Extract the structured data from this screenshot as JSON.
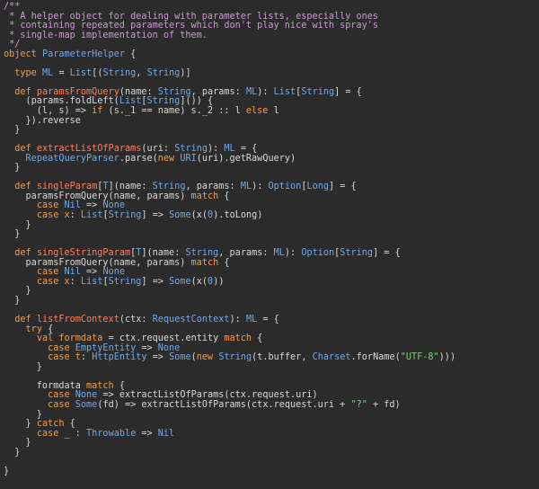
{
  "editor": {
    "language": "scala",
    "theme": {
      "background": "#2b2b2b",
      "text": "#d8d8d8",
      "comment": "#c89bd0",
      "keyword": "#f29d45",
      "type": "#6fa9e8",
      "definition": "#ff7f5a",
      "string": "#7bd17b"
    },
    "lines": [
      [
        [
          "c",
          "/**"
        ]
      ],
      [
        [
          "c",
          " * A helper object for dealing with parameter lists, especially ones"
        ]
      ],
      [
        [
          "c",
          " * containing repeated parameters which don't play nice with spray's"
        ]
      ],
      [
        [
          "c",
          " * single-map implementation of them."
        ]
      ],
      [
        [
          "c",
          " */"
        ]
      ],
      [
        [
          "k",
          "object"
        ],
        [
          "t",
          " "
        ],
        [
          "y",
          "ParameterHelper"
        ],
        [
          "t",
          " {"
        ]
      ],
      [
        [
          "t",
          ""
        ]
      ],
      [
        [
          "t",
          "  "
        ],
        [
          "k",
          "type"
        ],
        [
          "t",
          " "
        ],
        [
          "y",
          "ML"
        ],
        [
          "t",
          " = "
        ],
        [
          "y",
          "List"
        ],
        [
          "t",
          "[("
        ],
        [
          "y",
          "String"
        ],
        [
          "t",
          ", "
        ],
        [
          "y",
          "String"
        ],
        [
          "t",
          ")]"
        ]
      ],
      [
        [
          "t",
          ""
        ]
      ],
      [
        [
          "t",
          "  "
        ],
        [
          "k",
          "def"
        ],
        [
          "t",
          " "
        ],
        [
          "d",
          "paramsFromQuery"
        ],
        [
          "t",
          "(name: "
        ],
        [
          "y",
          "String"
        ],
        [
          "t",
          ", params: "
        ],
        [
          "y",
          "ML"
        ],
        [
          "t",
          "): "
        ],
        [
          "y",
          "List"
        ],
        [
          "t",
          "["
        ],
        [
          "y",
          "String"
        ],
        [
          "t",
          "] = {"
        ]
      ],
      [
        [
          "t",
          "    (params.foldLeft("
        ],
        [
          "y",
          "List"
        ],
        [
          "t",
          "["
        ],
        [
          "y",
          "String"
        ],
        [
          "t",
          "]()) {"
        ]
      ],
      [
        [
          "t",
          "      (l, s) => "
        ],
        [
          "k",
          "if"
        ],
        [
          "t",
          " (s._1 == name) s._2 :: l "
        ],
        [
          "k",
          "else"
        ],
        [
          "t",
          " l"
        ]
      ],
      [
        [
          "t",
          "    }).reverse"
        ]
      ],
      [
        [
          "t",
          "  }"
        ]
      ],
      [
        [
          "t",
          ""
        ]
      ],
      [
        [
          "t",
          "  "
        ],
        [
          "k",
          "def"
        ],
        [
          "t",
          " "
        ],
        [
          "d",
          "extractListOfParams"
        ],
        [
          "t",
          "(uri: "
        ],
        [
          "y",
          "String"
        ],
        [
          "t",
          "): "
        ],
        [
          "y",
          "ML"
        ],
        [
          "t",
          " = {"
        ]
      ],
      [
        [
          "t",
          "    "
        ],
        [
          "y",
          "RepeatQueryParser"
        ],
        [
          "t",
          ".parse("
        ],
        [
          "k",
          "new"
        ],
        [
          "t",
          " "
        ],
        [
          "y",
          "URI"
        ],
        [
          "t",
          "(uri).getRawQuery)"
        ]
      ],
      [
        [
          "t",
          "  }"
        ]
      ],
      [
        [
          "t",
          ""
        ]
      ],
      [
        [
          "t",
          "  "
        ],
        [
          "k",
          "def"
        ],
        [
          "t",
          " "
        ],
        [
          "d",
          "singleParam"
        ],
        [
          "t",
          "["
        ],
        [
          "y",
          "T"
        ],
        [
          "t",
          "](name: "
        ],
        [
          "y",
          "String"
        ],
        [
          "t",
          ", params: "
        ],
        [
          "y",
          "ML"
        ],
        [
          "t",
          "): "
        ],
        [
          "y",
          "Option"
        ],
        [
          "t",
          "["
        ],
        [
          "y",
          "Long"
        ],
        [
          "t",
          "] = {"
        ]
      ],
      [
        [
          "t",
          "    paramsFromQuery(name, params) "
        ],
        [
          "k",
          "match"
        ],
        [
          "t",
          " {"
        ]
      ],
      [
        [
          "t",
          "      "
        ],
        [
          "k",
          "case"
        ],
        [
          "t",
          " "
        ],
        [
          "y",
          "Nil"
        ],
        [
          "t",
          " => "
        ],
        [
          "y",
          "None"
        ]
      ],
      [
        [
          "t",
          "      "
        ],
        [
          "k",
          "case"
        ],
        [
          "t",
          " "
        ],
        [
          "k",
          "x"
        ],
        [
          "t",
          ": "
        ],
        [
          "y",
          "List"
        ],
        [
          "t",
          "["
        ],
        [
          "y",
          "String"
        ],
        [
          "t",
          "] => "
        ],
        [
          "y",
          "Some"
        ],
        [
          "t",
          "(x("
        ],
        [
          "y",
          "0"
        ],
        [
          "t",
          ").toLong)"
        ]
      ],
      [
        [
          "t",
          "    }"
        ]
      ],
      [
        [
          "t",
          "  }"
        ]
      ],
      [
        [
          "t",
          ""
        ]
      ],
      [
        [
          "t",
          "  "
        ],
        [
          "k",
          "def"
        ],
        [
          "t",
          " "
        ],
        [
          "d",
          "singleStringParam"
        ],
        [
          "t",
          "["
        ],
        [
          "y",
          "T"
        ],
        [
          "t",
          "](name: "
        ],
        [
          "y",
          "String"
        ],
        [
          "t",
          ", params: "
        ],
        [
          "y",
          "ML"
        ],
        [
          "t",
          "): "
        ],
        [
          "y",
          "Option"
        ],
        [
          "t",
          "["
        ],
        [
          "y",
          "String"
        ],
        [
          "t",
          "] = {"
        ]
      ],
      [
        [
          "t",
          "    paramsFromQuery(name, params) "
        ],
        [
          "k",
          "match"
        ],
        [
          "t",
          " {"
        ]
      ],
      [
        [
          "t",
          "      "
        ],
        [
          "k",
          "case"
        ],
        [
          "t",
          " "
        ],
        [
          "y",
          "Nil"
        ],
        [
          "t",
          " => "
        ],
        [
          "y",
          "None"
        ]
      ],
      [
        [
          "t",
          "      "
        ],
        [
          "k",
          "case"
        ],
        [
          "t",
          " "
        ],
        [
          "k",
          "x"
        ],
        [
          "t",
          ": "
        ],
        [
          "y",
          "List"
        ],
        [
          "t",
          "["
        ],
        [
          "y",
          "String"
        ],
        [
          "t",
          "] => "
        ],
        [
          "y",
          "Some"
        ],
        [
          "t",
          "(x("
        ],
        [
          "y",
          "0"
        ],
        [
          "t",
          "))"
        ]
      ],
      [
        [
          "t",
          "    }"
        ]
      ],
      [
        [
          "t",
          "  }"
        ]
      ],
      [
        [
          "t",
          ""
        ]
      ],
      [
        [
          "t",
          "  "
        ],
        [
          "k",
          "def"
        ],
        [
          "t",
          " "
        ],
        [
          "d",
          "listFromContext"
        ],
        [
          "t",
          "(ctx: "
        ],
        [
          "y",
          "RequestContext"
        ],
        [
          "t",
          "): "
        ],
        [
          "y",
          "ML"
        ],
        [
          "t",
          " = {"
        ]
      ],
      [
        [
          "t",
          "    "
        ],
        [
          "k",
          "try"
        ],
        [
          "t",
          " {"
        ]
      ],
      [
        [
          "t",
          "      "
        ],
        [
          "k",
          "val"
        ],
        [
          "t",
          " "
        ],
        [
          "k",
          "formdata"
        ],
        [
          "t",
          " = ctx.request.entity "
        ],
        [
          "k",
          "match"
        ],
        [
          "t",
          " {"
        ]
      ],
      [
        [
          "t",
          "        "
        ],
        [
          "k",
          "case"
        ],
        [
          "t",
          " "
        ],
        [
          "y",
          "EmptyEntity"
        ],
        [
          "t",
          " => "
        ],
        [
          "y",
          "None"
        ]
      ],
      [
        [
          "t",
          "        "
        ],
        [
          "k",
          "case"
        ],
        [
          "t",
          " "
        ],
        [
          "k",
          "t"
        ],
        [
          "t",
          ": "
        ],
        [
          "y",
          "HttpEntity"
        ],
        [
          "t",
          " => "
        ],
        [
          "y",
          "Some"
        ],
        [
          "t",
          "("
        ],
        [
          "k",
          "new"
        ],
        [
          "t",
          " "
        ],
        [
          "y",
          "String"
        ],
        [
          "t",
          "(t.buffer, "
        ],
        [
          "y",
          "Charset"
        ],
        [
          "t",
          ".forName("
        ],
        [
          "s",
          "\"UTF-8\""
        ],
        [
          "t",
          ")))"
        ]
      ],
      [
        [
          "t",
          "      }"
        ]
      ],
      [
        [
          "t",
          ""
        ]
      ],
      [
        [
          "t",
          "      formdata "
        ],
        [
          "k",
          "match"
        ],
        [
          "t",
          " {"
        ]
      ],
      [
        [
          "t",
          "        "
        ],
        [
          "k",
          "case"
        ],
        [
          "t",
          " "
        ],
        [
          "y",
          "None"
        ],
        [
          "t",
          " => extractListOfParams(ctx.request.uri)"
        ]
      ],
      [
        [
          "t",
          "        "
        ],
        [
          "k",
          "case"
        ],
        [
          "t",
          " "
        ],
        [
          "y",
          "Some"
        ],
        [
          "t",
          "(fd) => extractListOfParams(ctx.request.uri + "
        ],
        [
          "s",
          "\"?\""
        ],
        [
          "t",
          " + fd)"
        ]
      ],
      [
        [
          "t",
          "      }"
        ]
      ],
      [
        [
          "t",
          "    } "
        ],
        [
          "k",
          "catch"
        ],
        [
          "t",
          " {"
        ]
      ],
      [
        [
          "t",
          "      "
        ],
        [
          "k",
          "case"
        ],
        [
          "t",
          " _ : "
        ],
        [
          "y",
          "Throwable"
        ],
        [
          "t",
          " => "
        ],
        [
          "y",
          "Nil"
        ]
      ],
      [
        [
          "t",
          "    }"
        ]
      ],
      [
        [
          "t",
          "  }"
        ]
      ],
      [
        [
          "t",
          ""
        ]
      ],
      [
        [
          "t",
          "}"
        ]
      ]
    ]
  }
}
